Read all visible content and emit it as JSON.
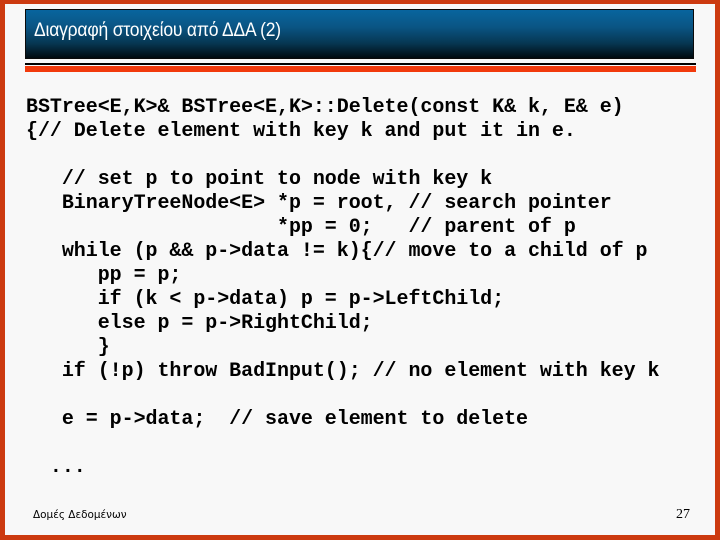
{
  "slide": {
    "title": "Διαγραφή στοιχείου από ΔΔΑ (2)",
    "code_lines": [
      "BSTree<E,K>& BSTree<E,K>::Delete(const K& k, E& e)",
      "{// Delete element with key k and put it in e.",
      "",
      "   // set p to point to node with key k",
      "   BinaryTreeNode<E> *p = root, // search pointer",
      "                     *pp = 0;   // parent of p",
      "   while (p && p->data != k){// move to a child of p",
      "      pp = p;",
      "      if (k < p->data) p = p->LeftChild;",
      "      else p = p->RightChild;",
      "      }",
      "   if (!p) throw BadInput(); // no element with key k",
      "",
      "   e = p->data;  // save element to delete",
      "",
      "  ..."
    ],
    "footer_text": "Δομές Δεδομένων",
    "page_number": "27"
  },
  "colors": {
    "frame": "#cc3a10",
    "accent_red": "#f23a0c",
    "header_blue": "#08659e"
  }
}
